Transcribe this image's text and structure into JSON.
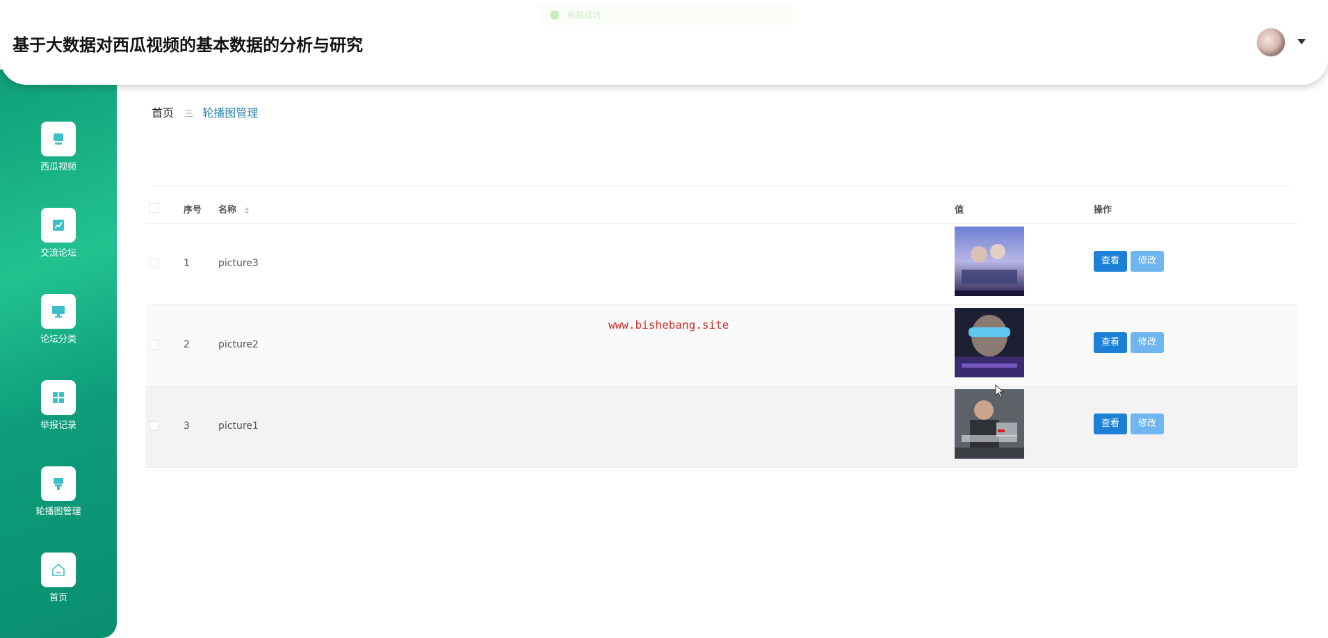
{
  "header": {
    "title": "基于大数据对西瓜视频的基本数据的分析与研究",
    "toast": "布局成功"
  },
  "sidebar": {
    "items": [
      {
        "label": "西瓜视频",
        "icon": "video-icon"
      },
      {
        "label": "交流论坛",
        "icon": "chart-line-icon"
      },
      {
        "label": "论坛分类",
        "icon": "monitor-icon"
      },
      {
        "label": "举报记录",
        "icon": "grid-icon"
      },
      {
        "label": "轮播图管理",
        "icon": "banner-icon"
      },
      {
        "label": "首页",
        "icon": "home-icon"
      }
    ]
  },
  "breadcrumb": {
    "home": "首页",
    "separator": "三",
    "current": "轮播图管理"
  },
  "table": {
    "columns": [
      "序号",
      "名称",
      "值",
      "操作"
    ],
    "rows": [
      {
        "index": "1",
        "name": "picture3",
        "view": "查看",
        "edit": "修改"
      },
      {
        "index": "2",
        "name": "picture2",
        "view": "查看",
        "edit": "修改"
      },
      {
        "index": "3",
        "name": "picture1",
        "view": "查看",
        "edit": "修改"
      }
    ]
  },
  "watermark": "www.bishebang.site",
  "colors": {
    "sidebar": "#15b083",
    "view_button": "#1c81d6",
    "edit_button": "#6fb5ef",
    "breadcrumb_active": "#2a7fa8"
  }
}
